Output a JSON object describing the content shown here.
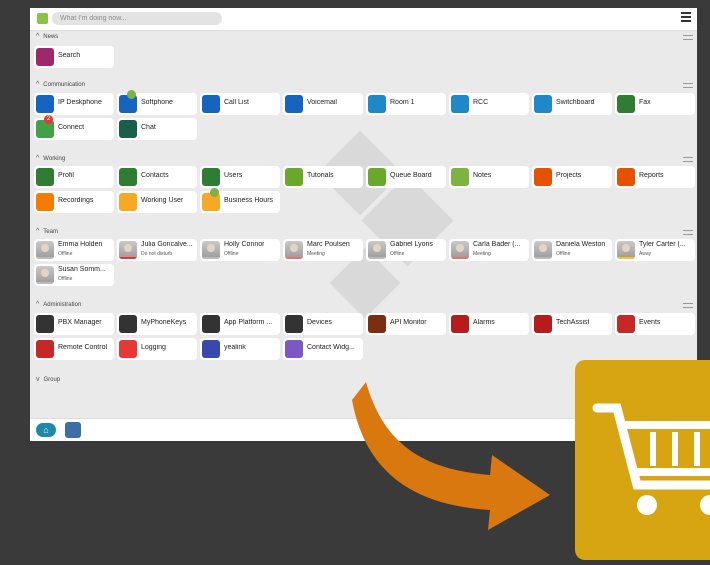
{
  "topbar": {
    "status_placeholder": "What I'm doing now..."
  },
  "sections": {
    "news": "News",
    "communication": "Communication",
    "working": "Working",
    "team": "Team",
    "administration": "Administration",
    "group": "Group"
  },
  "news_items": [
    {
      "label": "Search",
      "icon": "search-icon",
      "color": "#9c2a6a"
    }
  ],
  "communication_items": [
    {
      "label": "IP Deskphone",
      "icon": "deskphone-icon",
      "color": "#1565c0"
    },
    {
      "label": "Softphone",
      "icon": "softphone-icon",
      "color": "#1565c0",
      "badge": ""
    },
    {
      "label": "Call List",
      "icon": "call-list-icon",
      "color": "#1565c0"
    },
    {
      "label": "Voicemail",
      "icon": "voicemail-icon",
      "color": "#1565c0"
    },
    {
      "label": "Room 1",
      "icon": "room-icon",
      "color": "#1e88c8"
    },
    {
      "label": "RCC",
      "icon": "rcc-phone-icon",
      "color": "#1e88c8"
    },
    {
      "label": "Switchboard",
      "icon": "switchboard-icon",
      "color": "#1e88c8"
    },
    {
      "label": "Fax",
      "icon": "fax-icon",
      "color": "#2e7d32"
    },
    {
      "label": "Connect",
      "icon": "connect-icon",
      "color": "#43a047",
      "badge": "2"
    },
    {
      "label": "Chat",
      "icon": "chat-icon",
      "color": "#1b5e4a"
    }
  ],
  "working_items": [
    {
      "label": "Profil",
      "icon": "profile-icon",
      "color": "#2e7d32"
    },
    {
      "label": "Contacts",
      "icon": "contacts-icon",
      "color": "#2e7d32"
    },
    {
      "label": "Users",
      "icon": "users-icon",
      "color": "#2e7d32"
    },
    {
      "label": "Tutorials",
      "icon": "tutorials-icon",
      "color": "#6aa82c"
    },
    {
      "label": "Queue Board",
      "icon": "queue-board-icon",
      "color": "#6aa82c"
    },
    {
      "label": "Notes",
      "icon": "notes-icon",
      "color": "#7cb342"
    },
    {
      "label": "Projects",
      "icon": "projects-icon",
      "color": "#e65100"
    },
    {
      "label": "Reports",
      "icon": "reports-icon",
      "color": "#e65100"
    },
    {
      "label": "Recordings",
      "icon": "recordings-icon",
      "color": "#f57c00"
    },
    {
      "label": "Working User",
      "icon": "working-user-icon",
      "color": "#f9a825"
    },
    {
      "label": "Business Hours",
      "icon": "business-hours-icon",
      "color": "#f9a825",
      "badge": ""
    }
  ],
  "team_items": [
    {
      "label": "Emma Holden",
      "status": "Offline",
      "status_color": "#bbbbbb"
    },
    {
      "label": "Julia Goncalve...",
      "status": "Do not disturb",
      "status_color": "#e53935"
    },
    {
      "label": "Holly Connor",
      "status": "Offline",
      "status_color": "#bbbbbb"
    },
    {
      "label": "Marc Poulsen",
      "status": "Meeting",
      "status_color": "#e57373"
    },
    {
      "label": "Gabriel Lyons",
      "status": "Offline",
      "status_color": "#bbbbbb"
    },
    {
      "label": "Carla Bader (...",
      "status": "Meeting",
      "status_color": "#e57373"
    },
    {
      "label": "Daniela Weston",
      "status": "Offline",
      "status_color": "#bbbbbb"
    },
    {
      "label": "Tyler Carter (...",
      "status": "Away",
      "status_color": "#fbc02d"
    },
    {
      "label": "Susan Somm...",
      "status": "Offline",
      "status_color": "#bbbbbb"
    }
  ],
  "admin_items": [
    {
      "label": "PBX Manager",
      "icon": "pbx-manager-icon",
      "color": "#333333"
    },
    {
      "label": "MyPhoneKeys",
      "icon": "phonekeys-icon",
      "color": "#333333"
    },
    {
      "label": "App Platform ...",
      "icon": "app-platform-icon",
      "color": "#333333"
    },
    {
      "label": "Devices",
      "icon": "devices-icon",
      "color": "#333333"
    },
    {
      "label": "API Monitor",
      "icon": "api-monitor-icon",
      "color": "#7a2e12"
    },
    {
      "label": "Alarms",
      "icon": "alarms-icon",
      "color": "#b71c1c"
    },
    {
      "label": "TechAssist",
      "icon": "techassist-icon",
      "color": "#b71c1c"
    },
    {
      "label": "Events",
      "icon": "events-icon",
      "color": "#c62828"
    },
    {
      "label": "Remote Control",
      "icon": "remote-control-icon",
      "color": "#c62828"
    },
    {
      "label": "Logging",
      "icon": "logging-icon",
      "color": "#e53935"
    },
    {
      "label": "yealink",
      "icon": "yealink-icon",
      "color": "#3949ab"
    },
    {
      "label": "Contact Widg...",
      "icon": "contact-widget-icon",
      "color": "#7e57c2"
    }
  ],
  "colors": {
    "arrow": "#d9780f",
    "cart": "#d7a412",
    "home": "#1e88a8"
  }
}
